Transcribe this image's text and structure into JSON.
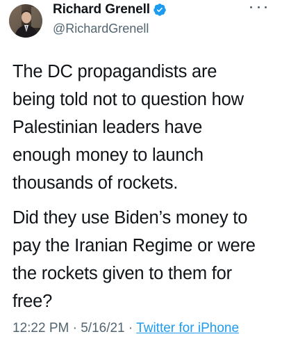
{
  "author": {
    "display_name": "Richard Grenell",
    "handle": "@RichardGrenell",
    "avatar_icon": "profile-photo",
    "verified_icon": "verified-badge-icon",
    "verified_color": "#1d9bf0"
  },
  "more_icon": "more-options-icon",
  "tweet": {
    "paragraphs": [
      "The DC propagandists are\nbeing told not to question how\nPalestinian leaders have\nenough money to launch\nthousands of rockets.",
      "Did they use Biden’s money to\npay the Iranian Regime or were\nthe rockets given to them for\nfree?"
    ]
  },
  "meta": {
    "time": "12:22 PM",
    "separator": " · ",
    "date": "5/16/21",
    "source": "Twitter for iPhone"
  },
  "colors": {
    "text": "#0f1419",
    "secondary": "#536471",
    "link": "#1d9bf0"
  }
}
